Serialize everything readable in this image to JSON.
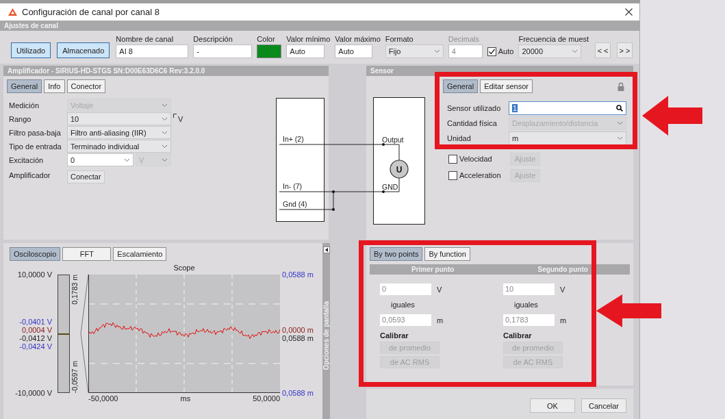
{
  "window": {
    "title": "Configuración de canal por canal 8"
  },
  "channel_settings": {
    "header": "Ajustes de canal",
    "toggles": [
      {
        "label": "Utilizado",
        "on": true
      },
      {
        "label": "Almacenado",
        "on": true
      }
    ],
    "fields": [
      {
        "kind": "text",
        "label": "Nombre de canal",
        "value": "AI 8"
      },
      {
        "kind": "text",
        "label": "Descripción",
        "value": "-"
      },
      {
        "kind": "color",
        "label": "Color",
        "color": "#0a8a1a"
      },
      {
        "kind": "text",
        "label": "Valor mínimo",
        "value": "Auto"
      },
      {
        "kind": "text",
        "label": "Valor máximo",
        "value": "Auto"
      },
      {
        "kind": "select",
        "label": "Formato",
        "value": "Fijo"
      },
      {
        "kind": "text",
        "label": "Decimals",
        "value": "4",
        "disabled": true
      },
      {
        "kind": "checkbox",
        "label": "Auto",
        "checked": true
      },
      {
        "kind": "select",
        "label": "Frecuencia de muest",
        "value": "20000"
      }
    ],
    "nav_buttons": [
      "< <",
      "> >"
    ]
  },
  "amplifier": {
    "header": "Amplificador - SIRIUS-HD-STGS  SN:D00E63D6C6 Rev:3.2.0.0",
    "tabs": [
      {
        "label": "General",
        "selected": true
      },
      {
        "label": "Info",
        "selected": false
      },
      {
        "label": "Conector",
        "selected": false
      }
    ],
    "rows": [
      {
        "label": "Medición",
        "kind": "select",
        "value": "Voltaje",
        "disabled": true
      },
      {
        "label": "Rango",
        "kind": "select",
        "value": "10",
        "disabled": false,
        "unit": "V"
      },
      {
        "label": "Filtro pasa-baja",
        "kind": "select",
        "value": "Filtro anti-aliasing (IIR)",
        "disabled": false
      },
      {
        "label": "Tipo de entrada",
        "kind": "select",
        "value": "Terminado individual",
        "disabled": false
      },
      {
        "label": "Excitación",
        "kind": "combo",
        "value": "0",
        "unit_select": {
          "value": "V",
          "disabled": true
        }
      },
      {
        "label": "Amplificador",
        "kind": "button",
        "value": "Conectar"
      }
    ]
  },
  "circuit": {
    "amp_pins": [
      "In+ (2)",
      "In- (7)",
      "Gnd (4)"
    ],
    "sensor_pins": [
      "Output",
      "GND"
    ],
    "source": "U"
  },
  "sensor": {
    "header": "Sensor",
    "tabs": [
      {
        "label": "General",
        "selected": true
      },
      {
        "label": "Editar sensor",
        "selected": false
      }
    ],
    "rows": [
      {
        "label": "Sensor utilizado",
        "kind": "search",
        "value": "1"
      },
      {
        "label": "Cantidad física",
        "kind": "select",
        "value": "Desplazamiento/distancia",
        "disabled": true
      },
      {
        "label": "Unidad",
        "kind": "select",
        "value": "m",
        "disabled": false
      }
    ],
    "options": [
      {
        "label": "Velocidad",
        "checked": false,
        "button": "Ajuste"
      },
      {
        "label": "Acceleration",
        "checked": false,
        "button": "Ajuste"
      }
    ]
  },
  "display": {
    "tabs": [
      {
        "label": "Osciloscopio",
        "selected": true
      },
      {
        "label": "FFT",
        "selected": false
      },
      {
        "label": "Escalamiento",
        "selected": false
      }
    ],
    "side_label": "Opciones de pantalla",
    "scope": {
      "title": "Scope",
      "y_top": "10,0000 V",
      "y_bottom": "-10,0000 V",
      "cursor_values": [
        {
          "text": "-0,0401 V",
          "color": "#3434c8"
        },
        {
          "text": "0,0004 V",
          "color": "#8b2020"
        },
        {
          "text": "-0,0412 V",
          "color": "#222222"
        },
        {
          "text": "-0,0424 V",
          "color": "#3434c8"
        }
      ],
      "range_top": "0,1783 m",
      "range_bottom": "-0,0597 m",
      "right_values": [
        {
          "text": "0,0588 m",
          "color": "#3434c8"
        },
        {
          "text": "0,0000 m",
          "color": "#8b2020"
        },
        {
          "text": "0,0588 m",
          "color": "#222222"
        },
        {
          "text": "0,0588 m",
          "color": "#3434c8"
        }
      ],
      "x_min": "-50,0000",
      "x_unit": "ms",
      "x_max": "50,0000"
    }
  },
  "calibration": {
    "tabs": [
      {
        "label": "By two points",
        "selected": true
      },
      {
        "label": "By function",
        "selected": false
      }
    ],
    "points": [
      {
        "heading": "Primer punto",
        "input": "0",
        "input_unit": "V",
        "equals": "iguales",
        "output": "0,0593",
        "output_unit": "m",
        "calibrate": "Calibrar",
        "buttons": [
          "de promedio",
          "de AC RMS"
        ]
      },
      {
        "heading": "Segundo punto",
        "input": "10",
        "input_unit": "V",
        "equals": "iguales",
        "output": "0,1783",
        "output_unit": "m",
        "calibrate": "Calibrar",
        "buttons": [
          "de promedio",
          "de AC RMS"
        ]
      }
    ]
  },
  "footer": {
    "buttons": [
      "OK",
      "Cancelar"
    ]
  }
}
